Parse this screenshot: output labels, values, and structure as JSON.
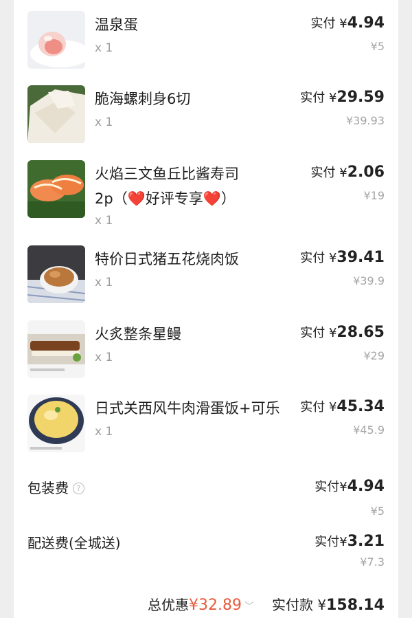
{
  "items": [
    {
      "name": "温泉蛋",
      "name2": "",
      "qty": "x 1",
      "pay_label": "实付",
      "pay_currency": "¥",
      "pay": "4.94",
      "original": "¥5"
    },
    {
      "name": "脆海螺刺身6切",
      "name2": "",
      "qty": "x 1",
      "pay_label": "实付",
      "pay_currency": "¥",
      "pay": "29.59",
      "original": "¥39.93"
    },
    {
      "name": "火焰三文鱼丘比酱寿司",
      "name2": "2p（❤️好评专享❤️）",
      "qty": "x 1",
      "pay_label": "实付",
      "pay_currency": "¥",
      "pay": "2.06",
      "original": "¥19"
    },
    {
      "name": "特价日式猪五花烧肉饭",
      "name2": "",
      "qty": "x 1",
      "pay_label": "实付",
      "pay_currency": "¥",
      "pay": "39.41",
      "original": "¥39.9"
    },
    {
      "name": "火炙整条星鳗",
      "name2": "",
      "qty": "x 1",
      "pay_label": "实付",
      "pay_currency": "¥",
      "pay": "28.65",
      "original": "¥29"
    },
    {
      "name": "日式关西风牛肉滑蛋饭+可乐",
      "name2": "",
      "qty": "x 1",
      "pay_label": "实付",
      "pay_currency": "¥",
      "pay": "45.34",
      "original": "¥45.9"
    }
  ],
  "fees": [
    {
      "label": "包装费",
      "pay_label": "实付",
      "pay_currency": "¥",
      "pay": "4.94",
      "original": "¥5"
    },
    {
      "label": "配送费(全城送)",
      "pay_label": "实付",
      "pay_currency": "¥",
      "pay": "3.21",
      "original": "¥7.3"
    }
  ],
  "summary": {
    "discount_label": "总优惠",
    "discount_value": "¥32.89",
    "paid_label": "实付款",
    "paid_currency": "¥",
    "paid_value": "158.14"
  },
  "colors": {
    "discount": "#e85a3c",
    "muted": "#9c9c9c"
  },
  "icons": {
    "help": "question-circle-icon",
    "expand": "chevron-down-icon"
  }
}
